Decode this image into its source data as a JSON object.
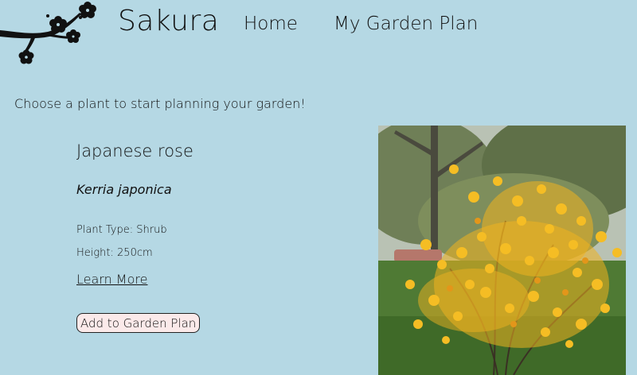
{
  "colors": {
    "background": "#b5d8e4",
    "button_background": "#fbeaea",
    "text": "#111111"
  },
  "header": {
    "brand": "Sakura",
    "nav": [
      {
        "label": "Home"
      },
      {
        "label": "My Garden Plan"
      }
    ]
  },
  "intro": "Choose a plant to start planning your garden!",
  "plant": {
    "common_name": "Japanese rose",
    "scientific_name": "Kerria japonica",
    "type_text": "Plant Type: Shrub",
    "height_text": "Height: 250cm",
    "learn_more_label": "Learn More",
    "add_button_label": "Add to Garden Plan",
    "image_icon": "kerria-photo"
  }
}
